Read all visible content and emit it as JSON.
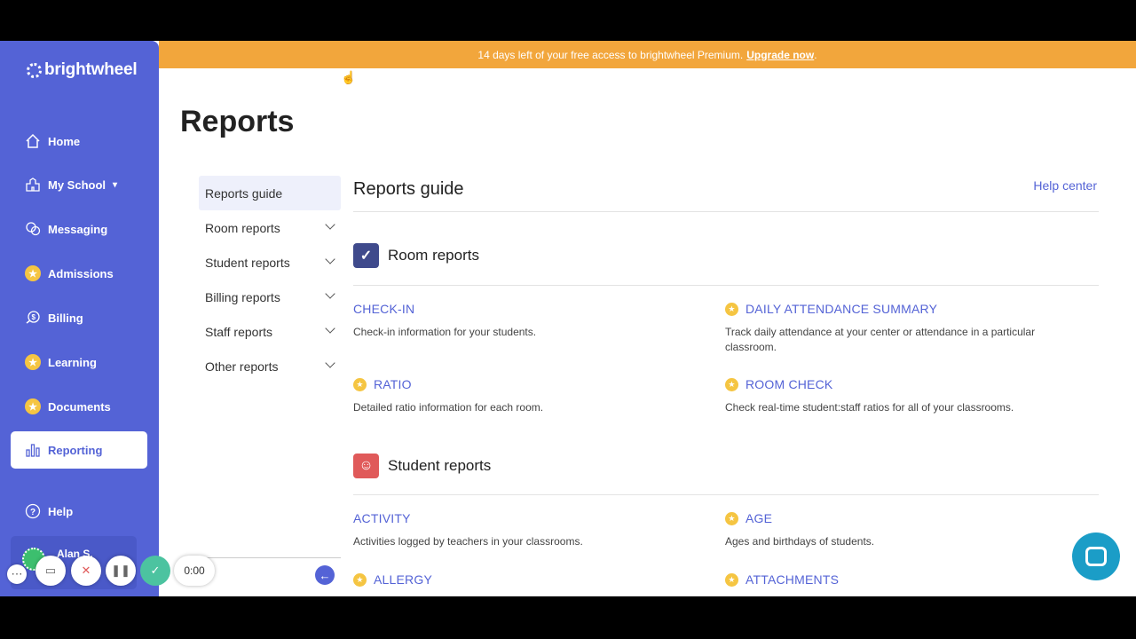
{
  "app": {
    "logo": "brightwheel"
  },
  "banner": {
    "text": "14 days left of your free access to brightwheel Premium.",
    "link": "Upgrade now",
    "suffix": "."
  },
  "sidebar": {
    "items": [
      {
        "label": "Home"
      },
      {
        "label": "My School"
      },
      {
        "label": "Messaging"
      },
      {
        "label": "Admissions"
      },
      {
        "label": "Billing"
      },
      {
        "label": "Learning"
      },
      {
        "label": "Documents"
      },
      {
        "label": "Reporting"
      },
      {
        "label": "Help"
      }
    ],
    "user": "Alan S."
  },
  "page": {
    "title": "Reports"
  },
  "subnav": [
    {
      "label": "Reports guide"
    },
    {
      "label": "Room reports"
    },
    {
      "label": "Student reports"
    },
    {
      "label": "Billing reports"
    },
    {
      "label": "Staff reports"
    },
    {
      "label": "Other reports"
    }
  ],
  "main": {
    "title": "Reports guide",
    "help": "Help center",
    "sections": [
      {
        "title": "Room reports",
        "reports": [
          {
            "title": "CHECK-IN",
            "desc": "Check-in information for your students."
          },
          {
            "title": "DAILY ATTENDANCE SUMMARY",
            "desc": "Track daily attendance at your center or attendance in a particular classroom."
          },
          {
            "title": "RATIO",
            "desc": "Detailed ratio information for each room."
          },
          {
            "title": "ROOM CHECK",
            "desc": "Check real-time student:staff ratios for all of your classrooms."
          }
        ]
      },
      {
        "title": "Student reports",
        "reports": [
          {
            "title": "ACTIVITY",
            "desc": "Activities logged by teachers in your classrooms."
          },
          {
            "title": "AGE",
            "desc": "Ages and birthdays of students."
          },
          {
            "title": "ALLERGY",
            "desc": ""
          },
          {
            "title": "ATTACHMENTS",
            "desc": ""
          }
        ]
      }
    ]
  },
  "recorder": {
    "time": "0:00"
  },
  "colors": {
    "primary": "#5463d6",
    "banner": "#f2a63c",
    "star": "#f5c542"
  }
}
